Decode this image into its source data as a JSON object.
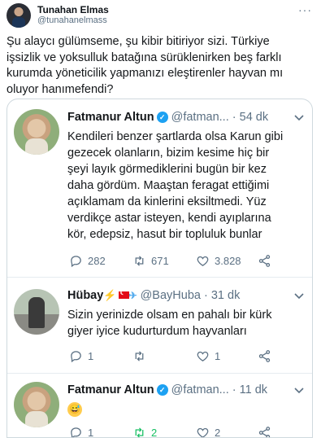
{
  "author": {
    "name": "Tunahan Elmas",
    "handle": "@tunahanelmass",
    "more": "···"
  },
  "tweet": {
    "text_lines": [
      "Şu alaycı gülümseme, şu kibir bitiriyor sizi. Türkiye",
      "işsizlik ve yoksulluk batağına sürüklenirken beş farklı",
      "kurumda yöneticilik yapmanızı eleştirenler hayvan mı",
      "oluyor hanımefendi?"
    ]
  },
  "embedded": {
    "posts": [
      {
        "name": "Fatmanur Altun",
        "verified": "✓",
        "handle": "@fatman...",
        "time": "· 54 dk",
        "text_lines": [
          "Kendileri benzer şartlarda olsa Karun gibi",
          "gezecek olanların, bizim kesime hiç bir",
          "şeyi layık görmediklerini bugün bir kez",
          "daha gördüm. Maaştan feragat ettiğimi",
          "açıklamam da kinlerini eksiltmedi. Yüz",
          "verdikçe astar isteyen, kendi ayıplarına",
          "kör, edepsiz, hasut bir topluluk bunlar"
        ],
        "replies": "282",
        "retweets": "671",
        "likes": "3.828"
      },
      {
        "name": "Hübay",
        "bolt": "⚡",
        "plane": "✈",
        "handle": "@BayHuba",
        "time": "· 31 dk",
        "text_lines": [
          "Sizin yerinizde olsam en pahalı  bir kürk",
          "giyer iyice kudurturdum hayvanları"
        ],
        "replies": "1",
        "retweets": "",
        "likes": "1"
      },
      {
        "name": "Fatmanur Altun",
        "verified": "✓",
        "handle": "@fatman...",
        "time": "· 11 dk",
        "emoji": "😅",
        "replies": "1",
        "retweets": "2",
        "likes": "2"
      }
    ]
  },
  "colors": {
    "accent": "#1da1f2",
    "muted": "#5b7083",
    "retweet_active": "#17bf63"
  }
}
